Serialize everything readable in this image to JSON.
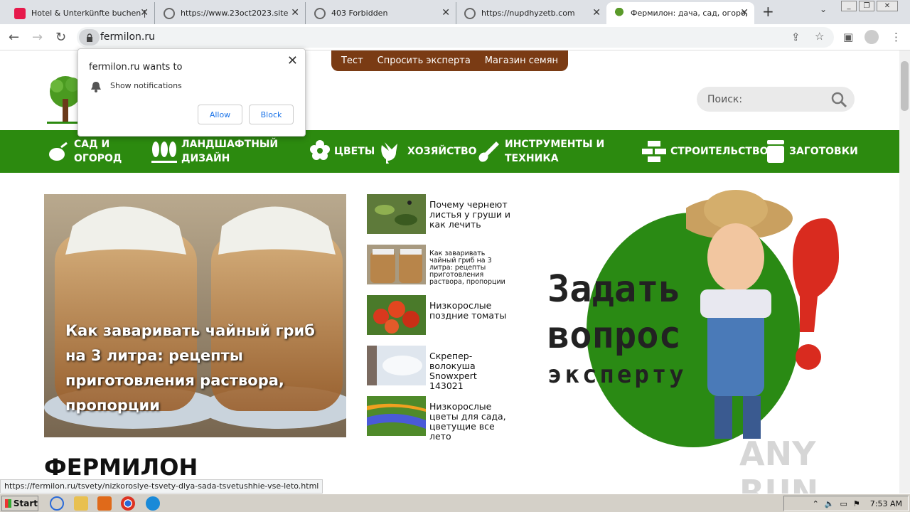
{
  "browser": {
    "tabs": [
      {
        "title": "Hotel & Unterkünfte buchen | A",
        "icon": "airbnb-icon"
      },
      {
        "title": "https://www.23oct2023.site",
        "icon": "globe-icon"
      },
      {
        "title": "403 Forbidden",
        "icon": "globe-icon"
      },
      {
        "title": "https://nupdhyzetb.com",
        "icon": "globe-icon"
      },
      {
        "title": "Фермилон: дача, сад, огород",
        "icon": "tree-icon",
        "active": true
      }
    ],
    "url": "fermilon.ru"
  },
  "notification_popup": {
    "title": "fermilon.ru wants to",
    "description": "Show notifications",
    "allow_label": "Allow",
    "block_label": "Block"
  },
  "site": {
    "top_menu": [
      "Тест",
      "Спросить эксперта",
      "Магазин семян"
    ],
    "search_placeholder": "Поиск:",
    "nav": [
      {
        "label": "САД И\nОГОРОД",
        "icon": "vegetables-icon"
      },
      {
        "label": "ЛАНДШАФТНЫЙ\nДИЗАЙН",
        "icon": "trees-icon"
      },
      {
        "label": "ЦВЕТЫ",
        "icon": "flower-icon"
      },
      {
        "label": "ХОЗЯЙСТВО",
        "icon": "rooster-icon"
      },
      {
        "label": "ИНСТРУМЕНТЫ И\nТЕХНИКА",
        "icon": "shovel-icon"
      },
      {
        "label": "СТРОИТЕЛЬСТВО",
        "icon": "bricks-icon"
      },
      {
        "label": "ЗАГОТОВКИ",
        "icon": "jar-icon"
      }
    ],
    "hero_caption": "Как заваривать чайный гриб на 3 литра: рецепты приготовления раствора, пропорции",
    "articles": [
      {
        "title": "Почему чернеют листья у груши и как лечить"
      },
      {
        "title": "Как заваривать чайный гриб на 3 литра: рецепты приготовления раствора, пропорции"
      },
      {
        "title": "Низкорослые поздние томаты"
      },
      {
        "title": "Скрепер-волокуша Snowxpert 143021"
      },
      {
        "title": "Низкорослые цветы для сада, цветущие все лето"
      }
    ],
    "ad": {
      "line1": "Задать",
      "line2": "вопрос",
      "line3": "эксперту"
    },
    "heading": "ФЕРМИЛОН"
  },
  "status_url": "https://fermilon.ru/tsvety/nizkoroslye-tsvety-dlya-sada-tsvetushhie-vse-leto.html",
  "watermark": "ANY RUN",
  "taskbar": {
    "start_label": "Start",
    "clock": "7:53 AM"
  }
}
